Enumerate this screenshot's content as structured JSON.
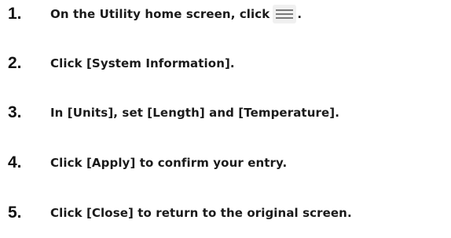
{
  "steps": [
    {
      "number": "1.",
      "text": "On the Utility home screen, click",
      "icon": "hamburger-menu-icon",
      "suffix": "."
    },
    {
      "number": "2.",
      "text": "Click [System Information]."
    },
    {
      "number": "3.",
      "text": "In [Units], set [Length] and [Temperature]."
    },
    {
      "number": "4.",
      "text": "Click [Apply] to confirm your entry."
    },
    {
      "number": "5.",
      "text": "Click [Close] to return to the original screen."
    }
  ]
}
